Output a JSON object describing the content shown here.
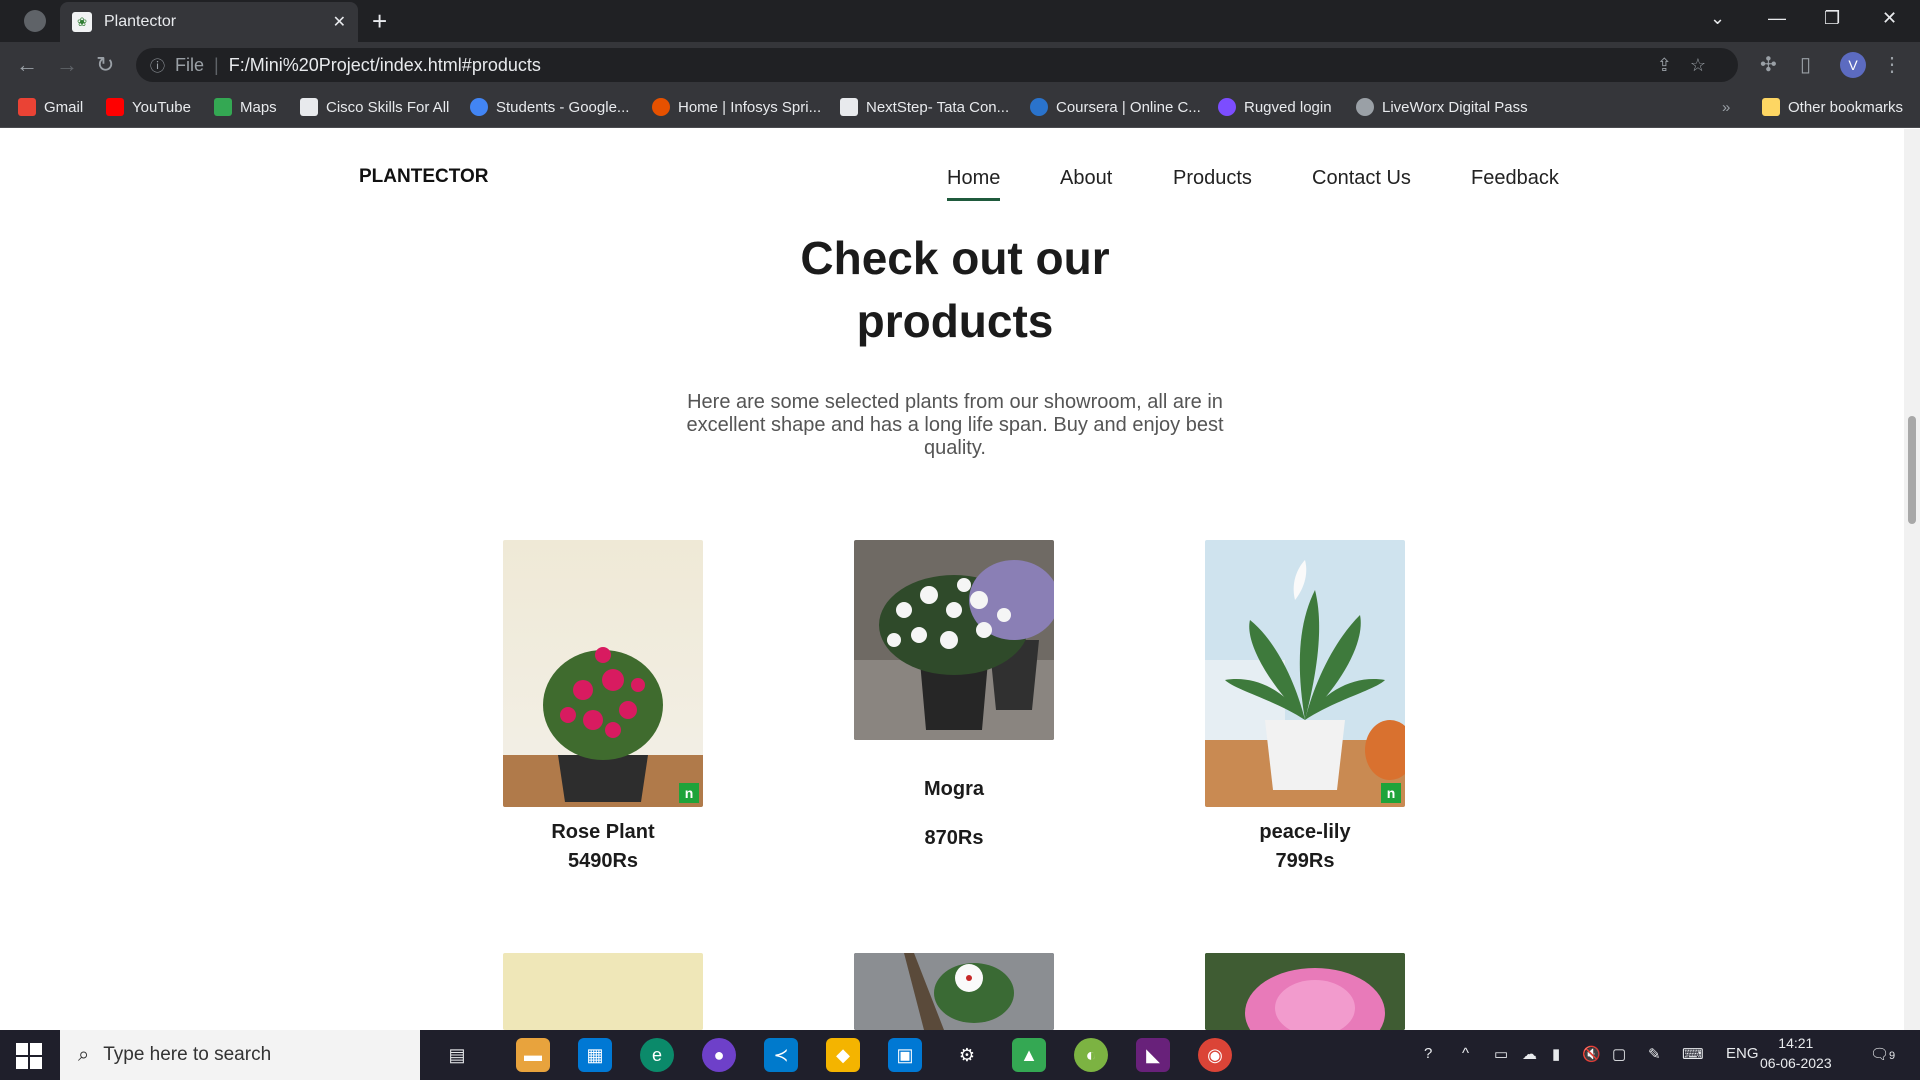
{
  "browser": {
    "tab_title": "Plantector",
    "scheme": "File",
    "url": "F:/Mini%20Project/index.html#products",
    "profile_initial": "V"
  },
  "bookmarks": [
    "Gmail",
    "YouTube",
    "Maps",
    "Cisco Skills For All",
    "Students - Google...",
    "Home | Infosys Spri...",
    "NextStep- Tata Con...",
    "Coursera | Online C...",
    "Rugved login",
    "LiveWorx Digital Pass"
  ],
  "other_bookmarks": "Other bookmarks",
  "site": {
    "brand": "PLANTECTOR",
    "nav": [
      "Home",
      "About",
      "Products",
      "Contact Us",
      "Feedback"
    ],
    "heading_line1": "Check out our",
    "heading_line2": "products",
    "subtitle": "Here are some selected plants from our showroom, all are in excellent shape and has a long life span. Buy and enjoy best quality.",
    "products": [
      {
        "name": "Rose Plant",
        "price": "5490Rs"
      },
      {
        "name": "Mogra",
        "price": "870Rs"
      },
      {
        "name": "peace-lily",
        "price": "799Rs"
      }
    ],
    "badge": "n"
  },
  "taskbar": {
    "search_placeholder": "Type here to search",
    "lang": "ENG",
    "time": "14:21",
    "date": "06-06-2023",
    "notif_count": "9"
  }
}
